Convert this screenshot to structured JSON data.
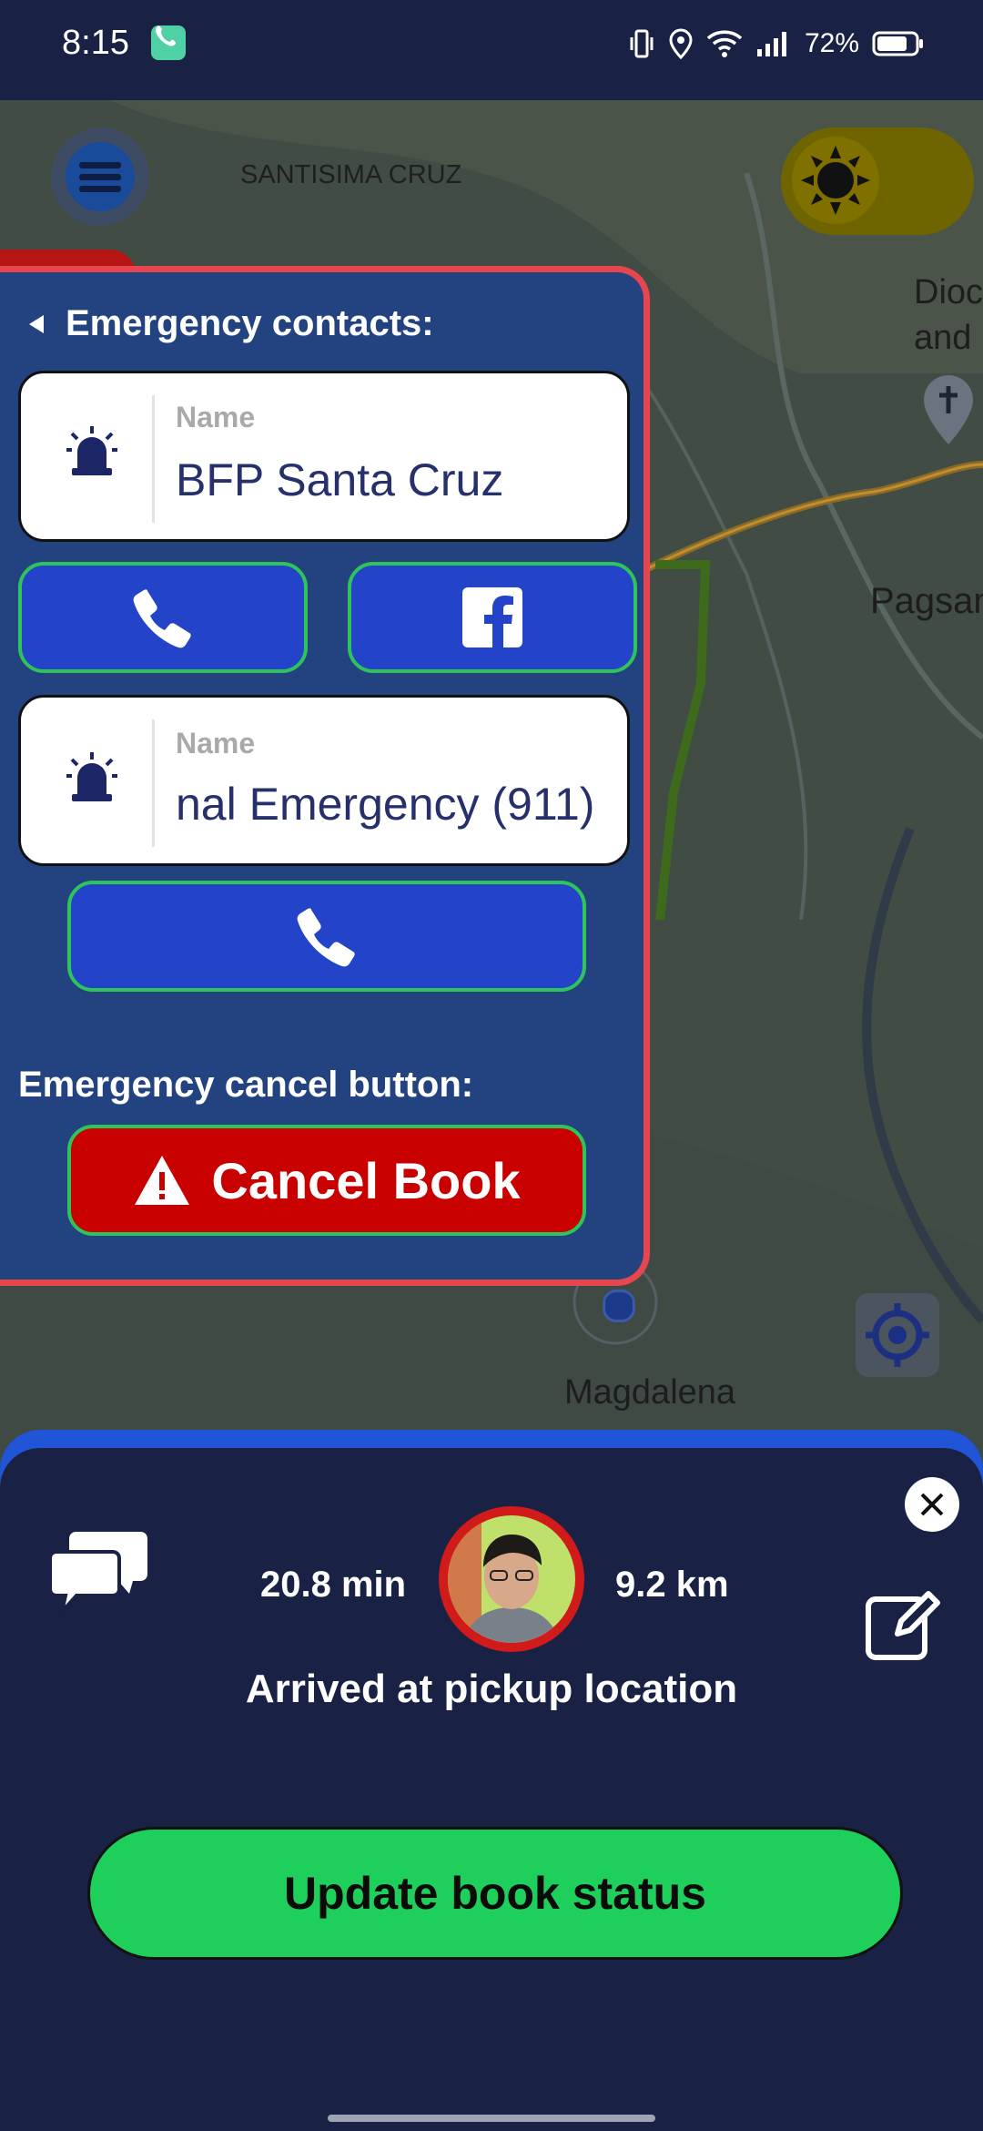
{
  "status_bar": {
    "time": "8:15",
    "battery": "72%"
  },
  "map": {
    "labels": {
      "santisima_cruz": "SANTISIMA CRUZ",
      "dioc": "Dioc",
      "and": "and",
      "pagsan": "Pagsan",
      "magdalena": "Magdalena"
    }
  },
  "emergency": {
    "contacts_title": "Emergency contacts:",
    "contacts": [
      {
        "name_label": "Name",
        "name": "BFP Santa Cruz"
      },
      {
        "name_label": "Name",
        "name": "nal Emergency (911)"
      }
    ],
    "cancel_title": "Emergency cancel button:",
    "cancel_label": "Cancel Book"
  },
  "trip": {
    "duration": "20.8 min",
    "distance": "9.2 km",
    "status": "Arrived at pickup location",
    "update_button": "Update book status"
  },
  "colors": {
    "panel_bg": "#234380",
    "panel_border": "#e8464f",
    "button_blue": "#2344c8",
    "button_green_border": "#2ec45a",
    "cancel_red": "#c80000",
    "update_green": "#1fcf5b",
    "sheet_bg": "#192245"
  }
}
